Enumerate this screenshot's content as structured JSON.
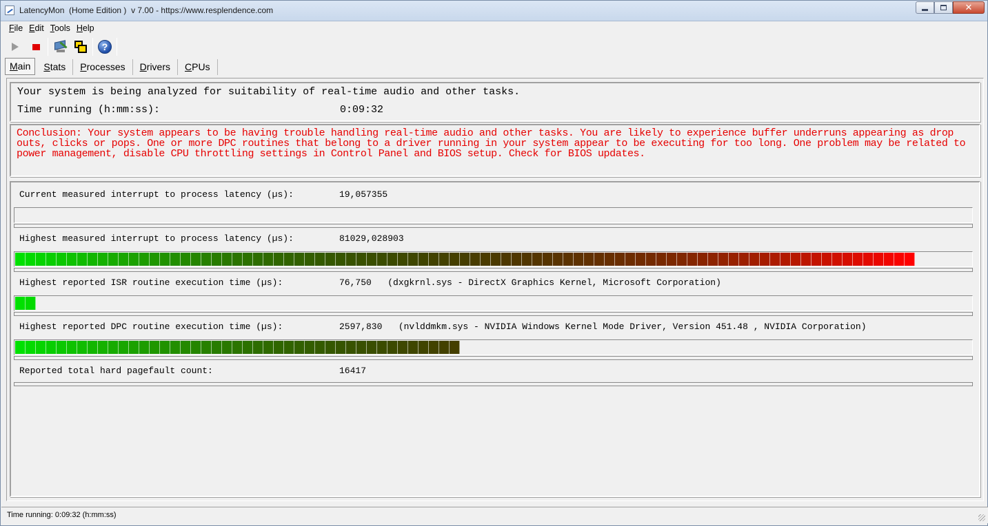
{
  "window": {
    "title": "LatencyMon  (Home Edition )  v 7.00 - https://www.resplendence.com"
  },
  "menu": [
    {
      "label": "File",
      "accel": "F",
      "rest": "ile"
    },
    {
      "label": "Edit",
      "accel": "E",
      "rest": "dit"
    },
    {
      "label": "Tools",
      "accel": "T",
      "rest": "ools"
    },
    {
      "label": "Help",
      "accel": "H",
      "rest": "elp"
    }
  ],
  "toolbar": {
    "icons": [
      "play-icon",
      "stop-icon",
      "monitor-icon",
      "windows-icon",
      "help-icon"
    ],
    "help_glyph": "?"
  },
  "tabs": [
    {
      "label": "Main",
      "accel": "M",
      "rest": "ain",
      "active": true
    },
    {
      "label": "Stats",
      "accel": "S",
      "rest": "tats",
      "active": false
    },
    {
      "label": "Processes",
      "accel": "P",
      "rest": "rocesses",
      "active": false
    },
    {
      "label": "Drivers",
      "accel": "D",
      "rest": "rivers",
      "active": false
    },
    {
      "label": "CPUs",
      "accel": "C",
      "rest": "PUs",
      "active": false
    }
  ],
  "status": {
    "line1": "Your system is being analyzed for suitability of real-time audio and other tasks.",
    "time_label": "Time running (h:mm:ss):",
    "time_value": "0:09:32"
  },
  "conclusion": "Conclusion: Your system appears to be having trouble handling real-time audio and other tasks. You are likely to experience buffer underruns appearing as drop outs, clicks or pops. One or more DPC routines that belong to a driver running in your system appear to be executing for too long. One problem may be related to power management, disable CPU throttling settings in Control Panel and BIOS setup. Check for BIOS updates.",
  "stats": {
    "current_latency": {
      "label": "Current measured interrupt to process latency (µs):",
      "value": "19,057355",
      "bar_segments": 0
    },
    "highest_latency": {
      "label": "Highest measured interrupt to process latency (µs):",
      "value": "81029,028903",
      "bar_segments": 87
    },
    "highest_isr": {
      "label": "Highest reported ISR routine execution time (µs):",
      "value": "76,750   (dxgkrnl.sys - DirectX Graphics Kernel, Microsoft Corporation)",
      "bar_segments": 2
    },
    "highest_dpc": {
      "label": "Highest reported DPC routine execution time (µs):",
      "value": "2597,830   (nvlddmkm.sys - NVIDIA Windows Kernel Mode Driver, Version 451.48 , NVIDIA Corporation)",
      "bar_segments": 43
    },
    "pagefault": {
      "label": "Reported total hard pagefault count:",
      "value": "16417"
    },
    "bar_total_segments": 87
  },
  "statusbar": {
    "text": "Time running: 0:09:32  (h:mm:ss)"
  },
  "colors": {
    "conclusion_red": "#e60000",
    "bar_green": "#00e000",
    "bar_red": "#ff0000"
  }
}
